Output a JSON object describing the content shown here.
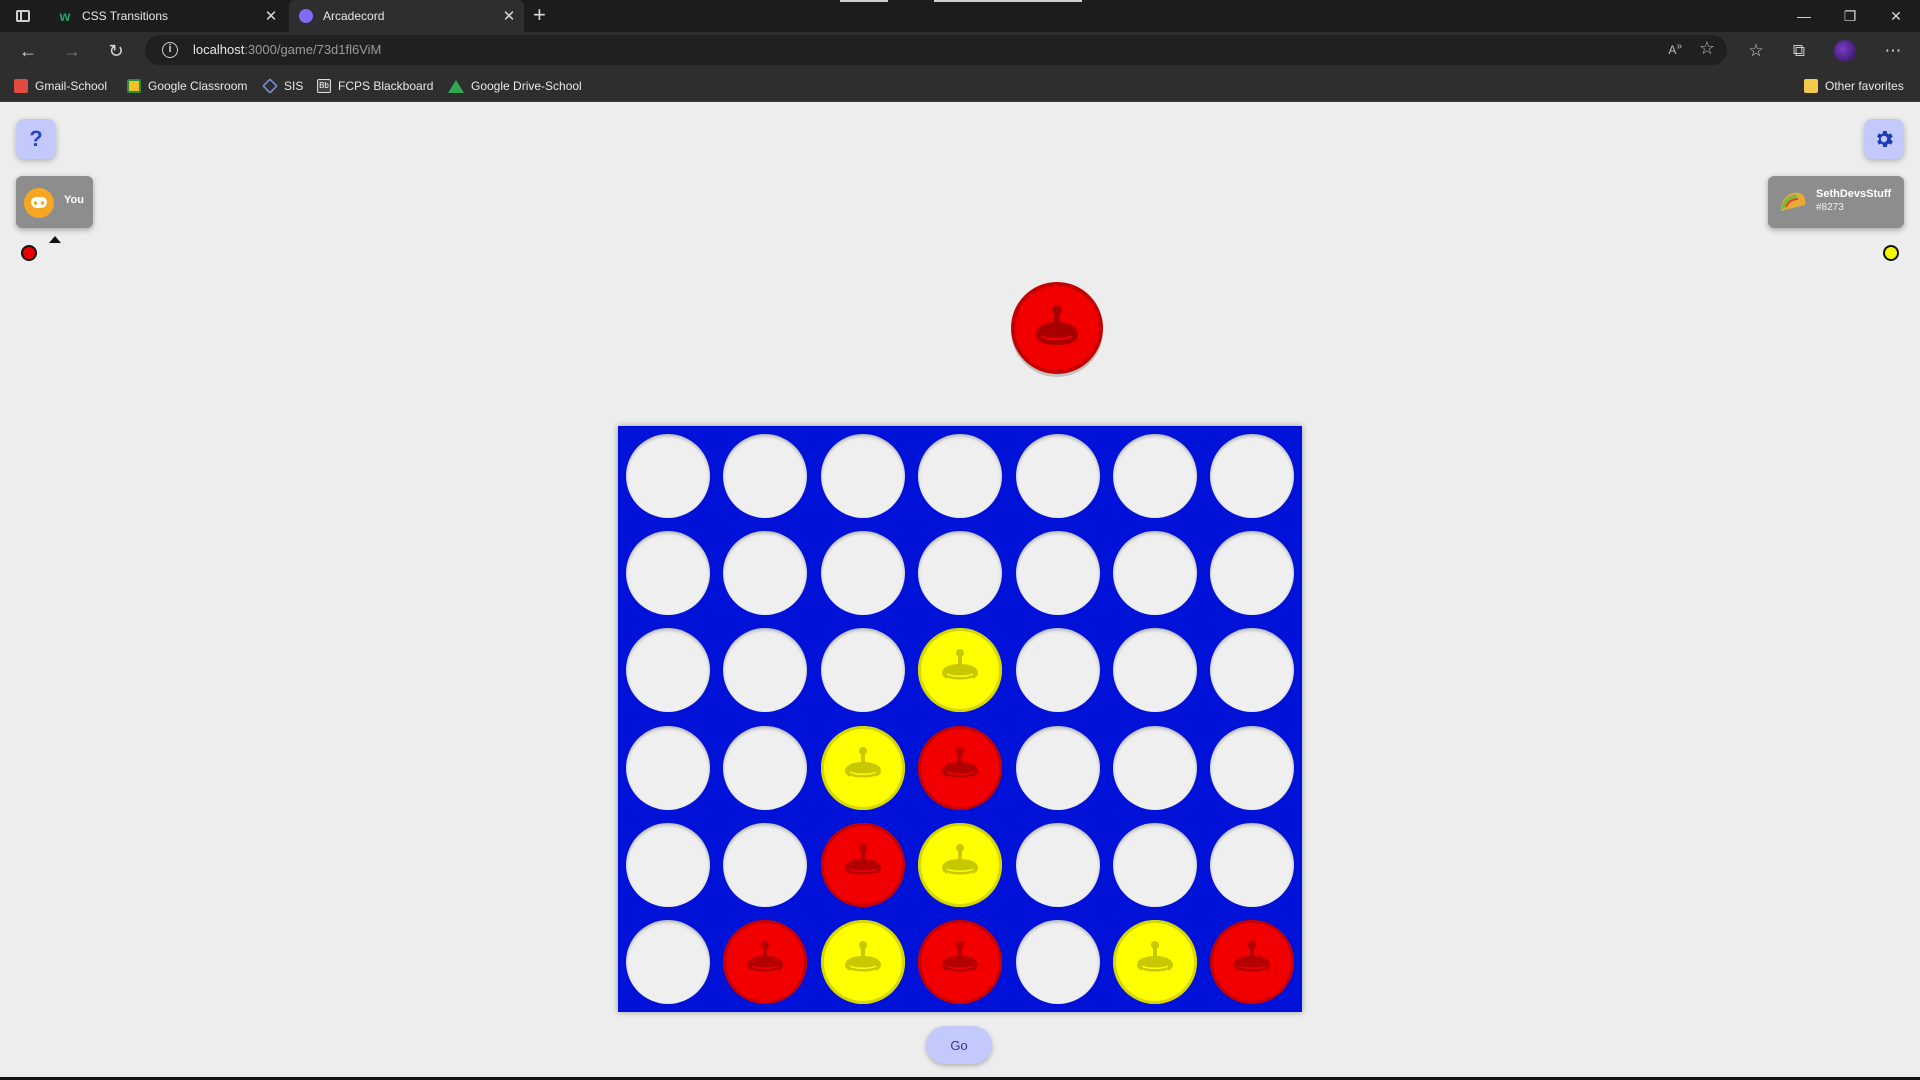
{
  "browser": {
    "tabs": [
      {
        "title": "CSS Transitions",
        "active": false
      },
      {
        "title": "Arcadecord",
        "active": true
      }
    ],
    "address": {
      "host": "localhost",
      "rest": ":3000/game/73d1fl6ViM"
    },
    "bookmarks": [
      "Gmail-School",
      "Google Classroom",
      "SIS",
      "FCPS Blackboard",
      "Google Drive-School"
    ],
    "other_favorites": "Other favorites"
  },
  "game": {
    "help_label": "?",
    "players": [
      {
        "name": "You",
        "color": "red",
        "color_hex": "#ee0000",
        "is_turn": true
      },
      {
        "name": "SethDevsStuff",
        "tag": "#8273",
        "color": "yellow",
        "color_hex": "#f5f500",
        "is_turn": false
      }
    ],
    "current_piece": "red",
    "go_label": "Go",
    "board_color": "#0011d8",
    "rows": 6,
    "cols": 7,
    "board": [
      [
        "",
        "",
        "",
        "",
        "",
        "",
        ""
      ],
      [
        "",
        "",
        "",
        "",
        "",
        "",
        ""
      ],
      [
        "",
        "",
        "",
        "Y",
        "",
        "",
        ""
      ],
      [
        "",
        "",
        "Y",
        "R",
        "",
        "",
        ""
      ],
      [
        "",
        "",
        "R",
        "Y",
        "",
        "",
        ""
      ],
      [
        "",
        "R",
        "Y",
        "R",
        "",
        "Y",
        "R"
      ]
    ]
  }
}
